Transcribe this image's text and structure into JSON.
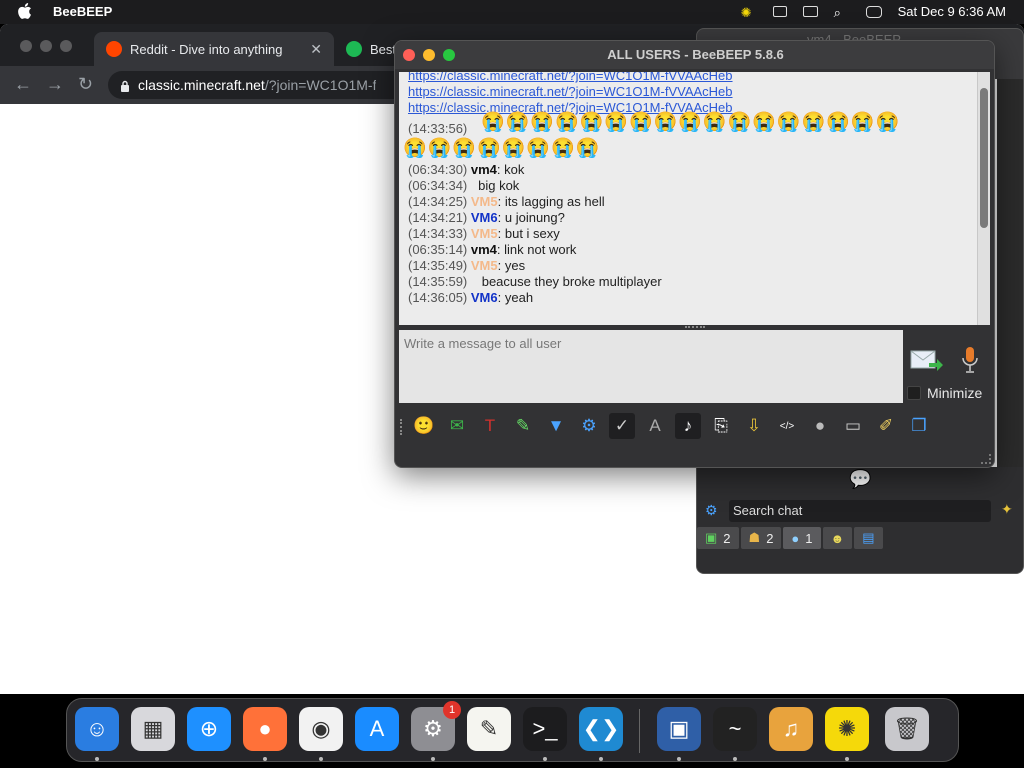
{
  "menubar": {
    "app_name": "BeeBEEP",
    "datetime": "Sat Dec 9  6:36 AM",
    "icons": [
      "apple-icon",
      "bee-status-icon",
      "screen-mirror-icon",
      "window-icon",
      "search-icon",
      "control-center-icon"
    ]
  },
  "browser": {
    "tabs": [
      {
        "label": "Reddit - Dive into anything",
        "icon": "reddit-icon",
        "active": true
      },
      {
        "label": "Best",
        "icon": "tab-favicon",
        "active": false
      }
    ],
    "url_host": "classic.minecraft.net",
    "url_path": "/?join=WC1O1M-f"
  },
  "bg_window": {
    "title": "vm4 - BeeBEEP",
    "search_placeholder": "Search chat",
    "tabs": [
      {
        "icon": "users-screen-icon",
        "count": "2"
      },
      {
        "icon": "group-icon",
        "count": "2"
      },
      {
        "icon": "chat-bubbles-icon",
        "count": "1"
      },
      {
        "icon": "people-icon",
        "count": ""
      },
      {
        "icon": "file-icon",
        "count": ""
      }
    ]
  },
  "chat": {
    "title": "ALL USERS - BeeBEEP 5.8.6",
    "links": [
      "https://classic.minecraft.net/?join=WC1O1M-fVVAAcHeb",
      "https://classic.minecraft.net/?join=WC1O1M-fVVAAcHeb"
    ],
    "emoji_timestamp": "(14:33:56)",
    "emoji_row1": "😭😭😭😭😭😭😭😭😭😭😭😭😭😭😭😭😭",
    "emoji_row2": "😭😭😭😭😭😭😭😭",
    "messages": [
      {
        "time": "(06:34:30)",
        "user": "vm4",
        "sep": ":",
        "text": " kok",
        "style": "vm4"
      },
      {
        "time": "(06:34:34)",
        "user": "",
        "sep": "",
        "text": "  big kok",
        "style": "none"
      },
      {
        "time": "(14:34:25)",
        "user": "VM5",
        "sep": ":",
        "text": " its lagging as hell",
        "style": "vm5"
      },
      {
        "time": "(14:34:21)",
        "user": "VM6",
        "sep": ":",
        "text": " u joinung?",
        "style": "vm6"
      },
      {
        "time": "(14:34:33)",
        "user": "VM5",
        "sep": ":",
        "text": " but i sexy",
        "style": "vm5"
      },
      {
        "time": "(06:35:14)",
        "user": "vm4",
        "sep": ":",
        "text": " link not work",
        "style": "vm4"
      },
      {
        "time": "(14:35:49)",
        "user": "VM5",
        "sep": ":",
        "text": " yes",
        "style": "vm5"
      },
      {
        "time": "(14:35:59)",
        "user": "",
        "sep": "",
        "text": "   beacuse they broke multiplayer",
        "style": "none"
      },
      {
        "time": "(14:36:05)",
        "user": "VM6",
        "sep": ":",
        "text": " yeah",
        "style": "vm6"
      }
    ],
    "compose_placeholder": "Write a message to all user",
    "minimize_label": "Minimize",
    "toolbar": [
      {
        "name": "emoticon-button",
        "glyph": "🙂"
      },
      {
        "name": "email-button",
        "glyph": "✉"
      },
      {
        "name": "font-button",
        "glyph": "T"
      },
      {
        "name": "color-button",
        "glyph": "✎"
      },
      {
        "name": "filter-button",
        "glyph": "▼"
      },
      {
        "name": "settings-button",
        "glyph": "⚙"
      },
      {
        "name": "spellcheck-button",
        "glyph": "✓"
      },
      {
        "name": "word-complete-button",
        "glyph": "A"
      },
      {
        "name": "music-note-button",
        "glyph": "♪"
      },
      {
        "name": "save-chat-button",
        "glyph": "⎘"
      },
      {
        "name": "send-file-button",
        "glyph": "⇩"
      },
      {
        "name": "html-button",
        "glyph": "</>"
      },
      {
        "name": "record-button",
        "glyph": "●"
      },
      {
        "name": "screenshot-button",
        "glyph": "▭"
      },
      {
        "name": "notes-button",
        "glyph": "✐"
      },
      {
        "name": "detach-button",
        "glyph": "❐"
      }
    ]
  },
  "dock": {
    "apps": [
      {
        "name": "finder-icon",
        "glyph": "☺",
        "bg": "#2a7de1"
      },
      {
        "name": "launchpad-icon",
        "glyph": "▦",
        "bg": "#d8d8dc"
      },
      {
        "name": "safari-icon",
        "glyph": "⊕",
        "bg": "#1e90ff"
      },
      {
        "name": "firefox-icon",
        "glyph": "●",
        "bg": "#ff7139"
      },
      {
        "name": "chrome-icon",
        "glyph": "◉",
        "bg": "#f2f2f2"
      },
      {
        "name": "app-store-icon",
        "glyph": "A",
        "bg": "#1a8cff"
      },
      {
        "name": "system-settings-icon",
        "glyph": "⚙",
        "bg": "#8e8e93"
      },
      {
        "name": "textedit-icon",
        "glyph": "✎",
        "bg": "#f5f5f0"
      },
      {
        "name": "terminal-icon",
        "glyph": ">_",
        "bg": "#1c1c1e"
      },
      {
        "name": "vscode-icon",
        "glyph": "❮❯",
        "bg": "#1f8ad2"
      },
      {
        "name": "virtualbox-icon",
        "glyph": "▣",
        "bg": "#2f5fa7"
      },
      {
        "name": "activity-monitor-icon",
        "glyph": "~",
        "bg": "#222"
      },
      {
        "name": "garageband-icon",
        "glyph": "♫",
        "bg": "#e8a33d"
      },
      {
        "name": "beebeep-icon",
        "glyph": "✺",
        "bg": "#f5d90a"
      },
      {
        "name": "trash-icon",
        "glyph": "🗑",
        "bg": "#c8c8cc"
      }
    ],
    "settings_badge": "1"
  }
}
